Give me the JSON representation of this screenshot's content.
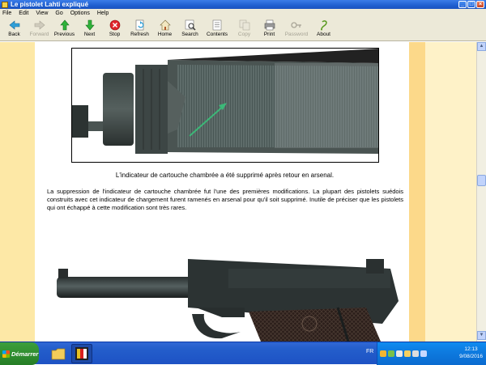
{
  "window": {
    "title": "Le pistolet Lahti expliqué"
  },
  "menu": [
    "File",
    "Edit",
    "View",
    "Go",
    "Options",
    "Help"
  ],
  "toolbar": [
    {
      "label": "Back",
      "icon": "arrow-left-icon",
      "enabled": true
    },
    {
      "label": "Forward",
      "icon": "arrow-right-icon",
      "enabled": false
    },
    {
      "label": "Previous",
      "icon": "arrow-up-icon",
      "enabled": true
    },
    {
      "label": "Next",
      "icon": "arrow-down-icon",
      "enabled": true
    },
    {
      "label": "Stop",
      "icon": "stop-icon",
      "enabled": true
    },
    {
      "label": "Refresh",
      "icon": "refresh-icon",
      "enabled": true
    },
    {
      "label": "Home",
      "icon": "home-icon",
      "enabled": true
    },
    {
      "label": "Search",
      "icon": "search-icon",
      "enabled": true
    },
    {
      "label": "Contents",
      "icon": "contents-icon",
      "enabled": true
    },
    {
      "label": "Copy",
      "icon": "copy-icon",
      "enabled": false
    },
    {
      "label": "Print",
      "icon": "print-icon",
      "enabled": true
    },
    {
      "label": "Password",
      "icon": "key-icon",
      "enabled": false
    },
    {
      "label": "About",
      "icon": "about-icon",
      "enabled": true
    }
  ],
  "page": {
    "caption": "L'indicateur de cartouche chambrée a été supprimé après retour en arsenal.",
    "paragraph": "La suppression de l'indicateur de cartouche chambrée fut l'une des premières modifications. La plupart des pistolets suédois construits avec cet indicateur de chargement furent ramenés en arsenal pour qu'il soit supprimé. Inutile de préciser que les pistolets qui ont échappé à cette modification sont très rares."
  },
  "taskbar": {
    "start_label": "Démarrer",
    "language": "FR",
    "time": "12:13",
    "date": "9/08/2016"
  },
  "colors": {
    "rail_left": "#fde8a6",
    "rail_right": "#fcd98a",
    "rail_far_right": "#fef2c8",
    "taskbar": "#245ecb",
    "start_button": "#2e8b2e",
    "arrow_annotation": "#3cb878"
  }
}
